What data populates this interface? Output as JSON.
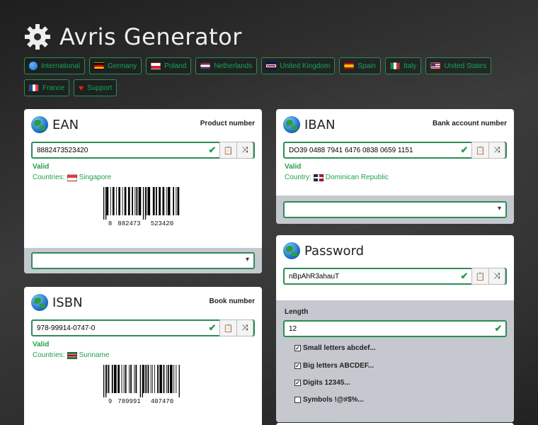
{
  "app": {
    "title": "Avris Generator"
  },
  "countries": [
    {
      "label": "International",
      "icon": "globe-icon",
      "flag": "globe"
    },
    {
      "label": "Germany",
      "icon": "flag-germany-icon",
      "flag": "de"
    },
    {
      "label": "Poland",
      "icon": "flag-poland-icon",
      "flag": "pl"
    },
    {
      "label": "Netherlands",
      "icon": "flag-netherlands-icon",
      "flag": "nl"
    },
    {
      "label": "United Kingdom",
      "icon": "flag-uk-icon",
      "flag": "uk"
    },
    {
      "label": "Spain",
      "icon": "flag-spain-icon",
      "flag": "es"
    },
    {
      "label": "Italy",
      "icon": "flag-italy-icon",
      "flag": "it"
    },
    {
      "label": "United States",
      "icon": "flag-usa-icon",
      "flag": "us"
    },
    {
      "label": "France",
      "icon": "flag-france-icon",
      "flag": "fr"
    },
    {
      "label": "Support",
      "icon": "heart-icon",
      "flag": "heart"
    }
  ],
  "ean": {
    "title": "EAN",
    "subtitle": "Product number",
    "value": "8882473523420",
    "status": "Valid",
    "countries_label": "Countries:",
    "country": "Singapore",
    "barcode": {
      "first": "8",
      "left": "882473",
      "right": "523420"
    }
  },
  "isbn": {
    "title": "ISBN",
    "subtitle": "Book number",
    "value": "978-99914-0747-0",
    "status": "Valid",
    "countries_label": "Countries:",
    "country": "Suriname",
    "barcode": {
      "first": "9",
      "left": "789991",
      "right": "407470"
    }
  },
  "iban": {
    "title": "IBAN",
    "subtitle": "Bank account number",
    "value": "DO39 0488 7941 6476 0838 0659 1151",
    "status": "Valid",
    "country_label": "Country:",
    "country": "Dominican Republic"
  },
  "password": {
    "title": "Password",
    "value": "nBpAhR3ahauT",
    "length_label": "Length",
    "length": "12",
    "options": [
      {
        "label": "Small letters abcdef...",
        "checked": true
      },
      {
        "label": "Big letters ABCDEF...",
        "checked": true
      },
      {
        "label": "Digits 12345...",
        "checked": true
      },
      {
        "label": "Symbols !@#$%...",
        "checked": false
      }
    ]
  },
  "colors": {
    "accent": "#2e8b57",
    "valid": "#23a04a",
    "footer": "#c5c8ce"
  }
}
